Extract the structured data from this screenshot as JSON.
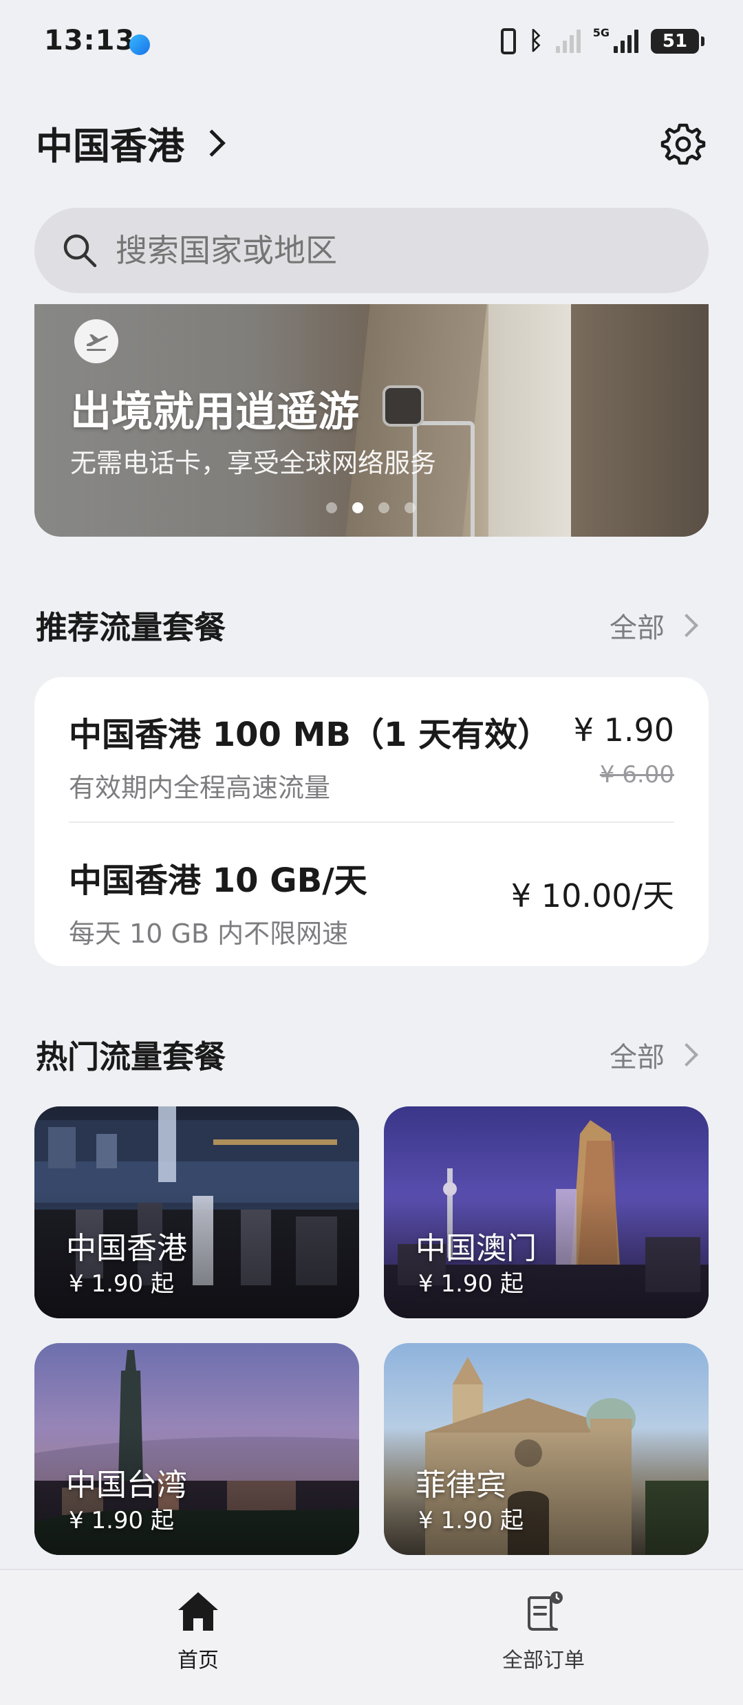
{
  "status_bar": {
    "time": "13:13",
    "network": "5G",
    "battery": "51"
  },
  "header": {
    "region": "中国香港"
  },
  "search": {
    "placeholder": "搜索国家或地区"
  },
  "banner": {
    "title": "出境就用逍遥游",
    "subtitle": "无需电话卡，享受全球网络服务",
    "page_count": 4,
    "active_page": 2
  },
  "recommended": {
    "title": "推荐流量套餐",
    "more_label": "全部",
    "items": [
      {
        "name": "中国香港 100 MB（1 天有效）",
        "desc": "有效期内全程高速流量",
        "price": "¥ 1.90",
        "old_price": "¥ 6.00"
      },
      {
        "name": "中国香港 10 GB/天",
        "desc": "每天 10 GB 内不限网速",
        "price": "¥ 10.00/天"
      }
    ]
  },
  "hot": {
    "title": "热门流量套餐",
    "more_label": "全部",
    "items": [
      {
        "name": "中国香港",
        "price": "¥ 1.90 起"
      },
      {
        "name": "中国澳门",
        "price": "¥ 1.90 起"
      },
      {
        "name": "中国台湾",
        "price": "¥ 1.90 起"
      },
      {
        "name": "菲律宾",
        "price": "¥ 1.90 起"
      }
    ]
  },
  "bottom_nav": {
    "items": [
      {
        "label": "首页",
        "icon": "home-icon",
        "active": true
      },
      {
        "label": "全部订单",
        "icon": "orders-icon",
        "active": false
      }
    ]
  }
}
